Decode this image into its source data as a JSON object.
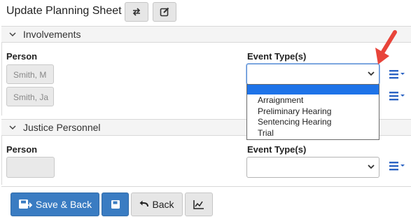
{
  "header": {
    "title": "Update Planning Sheet"
  },
  "involvements": {
    "label": "Involvements",
    "person_header": "Person",
    "event_header": "Event Type(s)",
    "persons": [
      "Smith, M",
      "Smith, Ja"
    ],
    "event_values": [
      "",
      ""
    ]
  },
  "dropdown": {
    "options": [
      "",
      "Arraignment",
      "Preliminary Hearing",
      "Sentencing Hearing",
      "Trial"
    ],
    "highlighted_index": 0
  },
  "justice_personnel": {
    "label": "Justice Personnel",
    "person_header": "Person",
    "event_header": "Event Type(s)",
    "person_value": "",
    "event_value": ""
  },
  "footer": {
    "save_back_label": "Save & Back",
    "back_label": "Back"
  },
  "colors": {
    "primary": "#3a7cc2",
    "highlight": "#1e73e8",
    "annotation_arrow": "#e8443a",
    "list_icon": "#2b63c4"
  }
}
